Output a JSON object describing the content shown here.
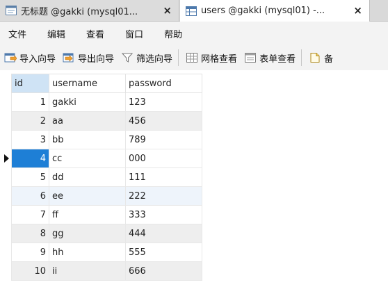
{
  "tabs": [
    {
      "title": "无标题 @gakki (mysql01...",
      "active": false,
      "close": "×",
      "icon": "query-icon"
    },
    {
      "title": "users @gakki (mysql01) -...",
      "active": true,
      "close": "×",
      "icon": "table-icon"
    }
  ],
  "menu": {
    "items": [
      "文件",
      "编辑",
      "查看",
      "窗口",
      "帮助"
    ]
  },
  "toolbar": {
    "import_wizard": "导入向导",
    "export_wizard": "导出向导",
    "filter_wizard": "筛选向导",
    "grid_view": "网格查看",
    "form_view": "表单查看",
    "memo_partial": "备"
  },
  "grid": {
    "columns": [
      "id",
      "username",
      "password"
    ],
    "rows": [
      {
        "id": "1",
        "username": "gakki",
        "password": "123"
      },
      {
        "id": "2",
        "username": "aa",
        "password": "456"
      },
      {
        "id": "3",
        "username": "bb",
        "password": "789"
      },
      {
        "id": "4",
        "username": "cc",
        "password": "000"
      },
      {
        "id": "5",
        "username": "dd",
        "password": "111"
      },
      {
        "id": "6",
        "username": "ee",
        "password": "222"
      },
      {
        "id": "7",
        "username": "ff",
        "password": "333"
      },
      {
        "id": "8",
        "username": "gg",
        "password": "444"
      },
      {
        "id": "9",
        "username": "hh",
        "password": "555"
      },
      {
        "id": "10",
        "username": "ii",
        "password": "666"
      }
    ],
    "selected_row": 4,
    "hover_row": 6
  },
  "colors": {
    "selection": "#1e7fd6",
    "header_highlight": "#cfe3f5",
    "row_alt": "#eeeeee"
  }
}
